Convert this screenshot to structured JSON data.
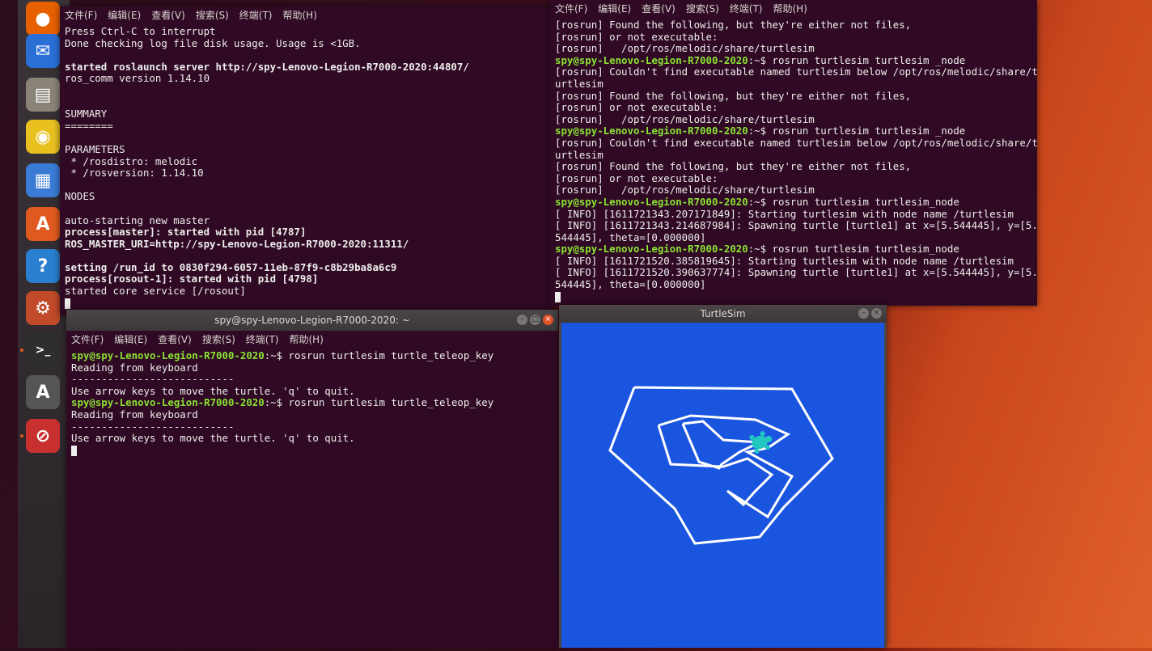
{
  "launcher": {
    "items": [
      {
        "name": "firefox-icon",
        "glyph": "●",
        "color": "#e66000"
      },
      {
        "name": "thunderbird-icon",
        "glyph": "✉",
        "color": "#2a6fd6"
      },
      {
        "name": "files-icon",
        "glyph": "▤",
        "color": "#8a8378"
      },
      {
        "name": "rhythmbox-icon",
        "glyph": "◉",
        "color": "#e8c020"
      },
      {
        "name": "libreoffice-writer-icon",
        "glyph": "▦",
        "color": "#3a7bd5"
      },
      {
        "name": "software-center-icon",
        "glyph": "A",
        "color": "#e05a20"
      },
      {
        "name": "help-icon",
        "glyph": "?",
        "color": "#2a7fd0"
      },
      {
        "name": "settings-icon",
        "glyph": "⚙",
        "color": "#c04a2a"
      },
      {
        "name": "terminal-icon",
        "glyph": ">_",
        "color": "#2e2e2e"
      },
      {
        "name": "software-updater-icon",
        "glyph": "A",
        "color": "#555"
      },
      {
        "name": "stop-app-icon",
        "glyph": "⊘",
        "color": "#c83030"
      }
    ]
  },
  "menu": [
    "文件(F)",
    "编辑(E)",
    "查看(V)",
    "搜索(S)",
    "终端(T)",
    "帮助(H)"
  ],
  "term_left": {
    "lines": [
      {
        "t": "Press Ctrl-C to interrupt",
        "s": ""
      },
      {
        "t": "Done checking log file disk usage. Usage is <1GB.",
        "s": ""
      },
      {
        "t": "",
        "s": ""
      },
      {
        "t": "started roslaunch server http://spy-Lenovo-Legion-R7000-2020:44807/",
        "s": "b"
      },
      {
        "t": "ros_comm version 1.14.10",
        "s": ""
      },
      {
        "t": "",
        "s": ""
      },
      {
        "t": "",
        "s": ""
      },
      {
        "t": "SUMMARY",
        "s": ""
      },
      {
        "t": "========",
        "s": ""
      },
      {
        "t": "",
        "s": ""
      },
      {
        "t": "PARAMETERS",
        "s": ""
      },
      {
        "t": " * /rosdistro: melodic",
        "s": ""
      },
      {
        "t": " * /rosversion: 1.14.10",
        "s": ""
      },
      {
        "t": "",
        "s": ""
      },
      {
        "t": "NODES",
        "s": ""
      },
      {
        "t": "",
        "s": ""
      },
      {
        "t": "auto-starting new master",
        "s": ""
      },
      {
        "t": "process[master]: started with pid [4787]",
        "s": "b"
      },
      {
        "t": "ROS_MASTER_URI=http://spy-Lenovo-Legion-R7000-2020:11311/",
        "s": "b"
      },
      {
        "t": "",
        "s": ""
      },
      {
        "t": "setting /run_id to 0830f294-6057-11eb-87f9-c8b29ba8a6c9",
        "s": "b"
      },
      {
        "t": "process[rosout-1]: started with pid [4798]",
        "s": "b"
      },
      {
        "t": "started core service [/rosout]",
        "s": ""
      }
    ]
  },
  "term_right": {
    "prompt": "spy@spy-Lenovo-Legion-R7000-2020",
    "lines": [
      {
        "p": "",
        "c": "[rosrun] Found the following, but they're either not files,"
      },
      {
        "p": "",
        "c": "[rosrun] or not executable:"
      },
      {
        "p": "",
        "c": "[rosrun]   /opt/ros/melodic/share/turtlesim"
      },
      {
        "p": "spy@spy-Lenovo-Legion-R7000-2020",
        "c": ":~$ rosrun turtlesim turtlesim _node"
      },
      {
        "p": "",
        "c": "[rosrun] Couldn't find executable named turtlesim below /opt/ros/melodic/share/t"
      },
      {
        "p": "",
        "c": "urtlesim"
      },
      {
        "p": "",
        "c": "[rosrun] Found the following, but they're either not files,"
      },
      {
        "p": "",
        "c": "[rosrun] or not executable:"
      },
      {
        "p": "",
        "c": "[rosrun]   /opt/ros/melodic/share/turtlesim"
      },
      {
        "p": "spy@spy-Lenovo-Legion-R7000-2020",
        "c": ":~$ rosrun turtlesim turtlesim _node"
      },
      {
        "p": "",
        "c": "[rosrun] Couldn't find executable named turtlesim below /opt/ros/melodic/share/t"
      },
      {
        "p": "",
        "c": "urtlesim"
      },
      {
        "p": "",
        "c": "[rosrun] Found the following, but they're either not files,"
      },
      {
        "p": "",
        "c": "[rosrun] or not executable:"
      },
      {
        "p": "",
        "c": "[rosrun]   /opt/ros/melodic/share/turtlesim"
      },
      {
        "p": "spy@spy-Lenovo-Legion-R7000-2020",
        "c": ":~$ rosrun turtlesim turtlesim_node"
      },
      {
        "p": "",
        "c": "[ INFO] [1611721343.207171849]: Starting turtlesim with node name /turtlesim"
      },
      {
        "p": "",
        "c": "[ INFO] [1611721343.214687984]: Spawning turtle [turtle1] at x=[5.544445], y=[5."
      },
      {
        "p": "",
        "c": "544445], theta=[0.000000]"
      },
      {
        "p": "spy@spy-Lenovo-Legion-R7000-2020",
        "c": ":~$ rosrun turtlesim turtlesim_node"
      },
      {
        "p": "",
        "c": "[ INFO] [1611721520.385819645]: Starting turtlesim with node name /turtlesim"
      },
      {
        "p": "",
        "c": "[ INFO] [1611721520.390637774]: Spawning turtle [turtle1] at x=[5.544445], y=[5."
      },
      {
        "p": "",
        "c": "544445], theta=[0.000000]"
      }
    ]
  },
  "term_bottom": {
    "title": "spy@spy-Lenovo-Legion-R7000-2020: ~",
    "lines": [
      {
        "p": "spy@spy-Lenovo-Legion-R7000-2020",
        "c": ":~$ rosrun turtlesim turtle_teleop_key"
      },
      {
        "p": "",
        "c": "Reading from keyboard"
      },
      {
        "p": "",
        "c": "---------------------------"
      },
      {
        "p": "",
        "c": "Use arrow keys to move the turtle. 'q' to quit."
      },
      {
        "p": "spy@spy-Lenovo-Legion-R7000-2020",
        "c": ":~$ rosrun turtlesim turtle_teleop_key"
      },
      {
        "p": "",
        "c": "Reading from keyboard"
      },
      {
        "p": "",
        "c": "---------------------------"
      },
      {
        "p": "",
        "c": "Use arrow keys to move the turtle. 'q' to quit."
      }
    ]
  },
  "turtlesim": {
    "title": "TurtleSim",
    "background": "#1a55e0",
    "trail_color": "#ffffff",
    "turtle_color": "#22c7c0"
  }
}
